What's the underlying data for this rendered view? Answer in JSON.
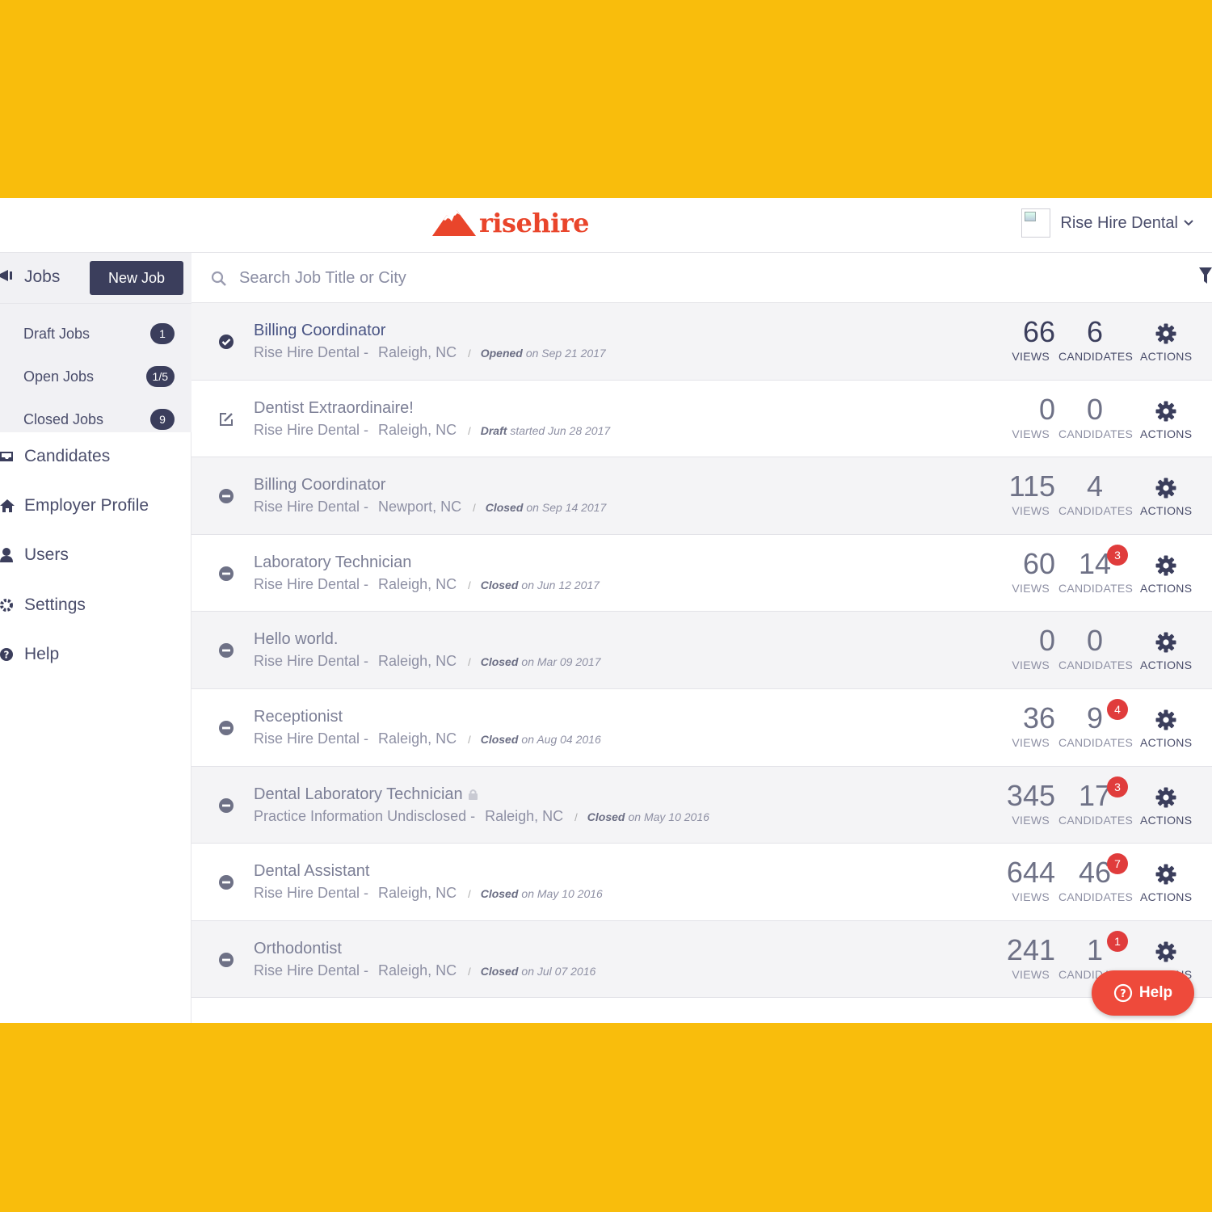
{
  "brand": {
    "name": "risehire",
    "color": "#e9452b"
  },
  "account": {
    "name": "Rise Hire Dental"
  },
  "sidebar": {
    "jobs_label": "Jobs",
    "new_job_label": "New Job",
    "sub_items": [
      {
        "label": "Draft Jobs",
        "count": "1"
      },
      {
        "label": "Open Jobs",
        "count": "1/5"
      },
      {
        "label": "Closed Jobs",
        "count": "9"
      }
    ],
    "nav": [
      {
        "label": "Candidates",
        "icon": "inbox-icon"
      },
      {
        "label": "Employer Profile",
        "icon": "home-icon"
      },
      {
        "label": "Users",
        "icon": "user-icon"
      },
      {
        "label": "Settings",
        "icon": "gear-icon"
      },
      {
        "label": "Help",
        "icon": "question-icon"
      }
    ]
  },
  "search": {
    "placeholder": "Search Job Title or City"
  },
  "labels": {
    "views": "VIEWS",
    "candidates": "CANDIDATES",
    "actions": "ACTIONS"
  },
  "jobs": [
    {
      "title": "Billing Coordinator",
      "company": "Rise Hire Dental -",
      "location": "Raleigh, NC",
      "status": "Opened",
      "date": "on Sep 21 2017",
      "views": "66",
      "candidates": "6",
      "badge": "",
      "state": "open"
    },
    {
      "title": "Dentist Extraordinaire!",
      "company": "Rise Hire Dental -",
      "location": "Raleigh, NC",
      "status": "Draft",
      "date": "started Jun 28 2017",
      "views": "0",
      "candidates": "0",
      "badge": "",
      "state": "draft"
    },
    {
      "title": "Billing Coordinator",
      "company": "Rise Hire Dental -",
      "location": "Newport, NC",
      "status": "Closed",
      "date": "on Sep 14 2017",
      "views": "115",
      "candidates": "4",
      "badge": "",
      "state": "closed"
    },
    {
      "title": "Laboratory Technician",
      "company": "Rise Hire Dental -",
      "location": "Raleigh, NC",
      "status": "Closed",
      "date": "on Jun 12 2017",
      "views": "60",
      "candidates": "14",
      "badge": "3",
      "state": "closed"
    },
    {
      "title": "Hello world.",
      "company": "Rise Hire Dental -",
      "location": "Raleigh, NC",
      "status": "Closed",
      "date": "on Mar 09 2017",
      "views": "0",
      "candidates": "0",
      "badge": "",
      "state": "closed"
    },
    {
      "title": "Receptionist",
      "company": "Rise Hire Dental -",
      "location": "Raleigh, NC",
      "status": "Closed",
      "date": "on Aug 04 2016",
      "views": "36",
      "candidates": "9",
      "badge": "4",
      "state": "closed"
    },
    {
      "title": "Dental Laboratory Technician",
      "company": "Practice Information Undisclosed -",
      "location": "Raleigh, NC",
      "status": "Closed",
      "date": "on May 10 2016",
      "views": "345",
      "candidates": "17",
      "badge": "3",
      "state": "closed",
      "locked": true
    },
    {
      "title": "Dental Assistant",
      "company": "Rise Hire Dental -",
      "location": "Raleigh, NC",
      "status": "Closed",
      "date": "on May 10 2016",
      "views": "644",
      "candidates": "46",
      "badge": "7",
      "state": "closed"
    },
    {
      "title": "Orthodontist",
      "company": "Rise Hire Dental -",
      "location": "Raleigh, NC",
      "status": "Closed",
      "date": "on Jul 07 2016",
      "views": "241",
      "candidates": "1",
      "badge": "1",
      "state": "closed"
    }
  ],
  "help_button": {
    "label": "Help"
  },
  "colors": {
    "frame": "#f9bd0c",
    "navy": "#3b3e5c",
    "badge_red": "#e03c3c",
    "help_red": "#ee4a3b"
  }
}
